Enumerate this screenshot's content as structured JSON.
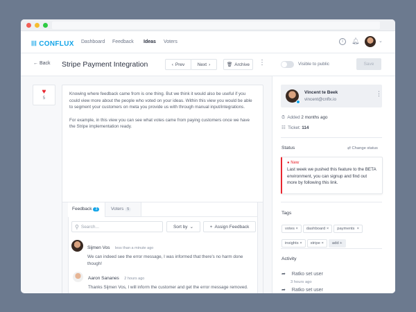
{
  "nav": {
    "brand": "CONFLUX",
    "links": [
      "Dashboard",
      "Feedback",
      "Ideas",
      "Voters"
    ],
    "active": "Ideas"
  },
  "toolbar": {
    "back": "Back",
    "title": "Stripe Payment Integration",
    "prev": "Prev",
    "next": "Next",
    "archive": "Archive",
    "visibility_label": "Visible to public",
    "visible": false,
    "save": "Save"
  },
  "votes": {
    "count": "5"
  },
  "description": [
    "Knowing where feedback came from is one thing. But we think it would also be useful if you could view more about the people who voted on your ideas. Within this view you would be able to segment your customers on meta you provide us with through manual input/integrations.",
    "For example, in this view you can see what votes came from paying customers once we have the Stripe implementation ready."
  ],
  "tabs": [
    {
      "label": "Feedback",
      "count": "3"
    },
    {
      "label": "Voters",
      "count": "5"
    }
  ],
  "search": {
    "placeholder": "Search..."
  },
  "sort": "Sort by",
  "assign": "Assign Feedback",
  "comments": [
    {
      "author": "Sijmen Vos",
      "time": "less than a minute ago",
      "text": "We can indeed see the error message, I was informed that there's no harm done though!"
    },
    {
      "author": "Aaron Sananes",
      "time": "2 hours ago",
      "text": "Thanks Sijmen Vos, I will inform the customer and get the error message removed."
    }
  ],
  "owner": {
    "name": "Vincent te Beek",
    "email": "vincent@cnflx.io"
  },
  "meta": {
    "added_label": "Added",
    "added": "2 months ago",
    "ticket_label": "Ticket:",
    "ticket": "114"
  },
  "status": {
    "heading": "Status",
    "change": "Change status",
    "label": "New",
    "text": "Last week we pushed this feature to the BETA environment, you can signup and find out more by following this link.",
    "color": "#e8262f"
  },
  "tags": {
    "heading": "Tags",
    "items": [
      "votes",
      "dashboard",
      "payments",
      "insights",
      "stripe"
    ],
    "add": "add"
  },
  "activity": {
    "heading": "Activity",
    "items": [
      {
        "text": "Ratko set user",
        "time": "3 hours ago"
      },
      {
        "text": "Ratko set user"
      }
    ]
  }
}
